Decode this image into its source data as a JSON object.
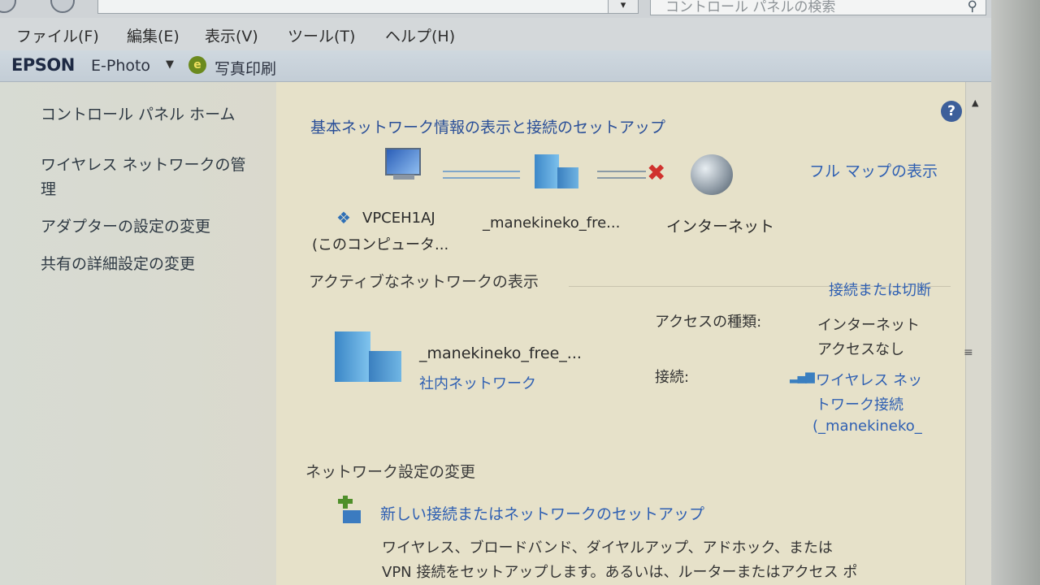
{
  "window": {
    "search_placeholder": "コントロール パネルの検索"
  },
  "menubar": {
    "items": [
      {
        "label": "ファイル(F)"
      },
      {
        "label": "編集(E)"
      },
      {
        "label": "表示(V)"
      },
      {
        "label": "ツール(T)"
      },
      {
        "label": "ヘルプ(H)"
      }
    ]
  },
  "toolbar": {
    "brand": "EPSON",
    "product": "E-Photo",
    "print_label": "写真印刷"
  },
  "sidebar": {
    "items": [
      {
        "label": "コントロール パネル ホーム"
      },
      {
        "label": "ワイヤレス ネットワークの管"
      },
      {
        "label": "理"
      },
      {
        "label": "アダプターの設定の変更"
      },
      {
        "label": "共有の詳細設定の変更"
      }
    ]
  },
  "main": {
    "title": "基本ネットワーク情報の表示と接続のセットアップ",
    "full_map": "フル マップの表示",
    "map": {
      "computer_name": "VPCEH1AJ",
      "computer_sub": "(このコンピュータ...",
      "network_name": "_manekineko_fre...",
      "internet": "インターネット"
    },
    "active_heading": "アクティブなネットワークの表示",
    "connect_link": "接続または切断",
    "active": {
      "name": "_manekineko_free_...",
      "type": "社内ネットワーク",
      "access_label": "アクセスの種類:",
      "access_value_1": "インターネット",
      "access_value_2": "アクセスなし",
      "connection_label": "接続:",
      "connection_value_1": "ワイヤレス ネッ",
      "connection_value_2": "トワーク接続",
      "connection_value_3": "(_manekineko_"
    },
    "change_heading": "ネットワーク設定の変更",
    "setup_link": "新しい接続またはネットワークのセットアップ",
    "setup_desc_1": "ワイヤレス、ブロードバンド、ダイヤルアップ、アドホック、または",
    "setup_desc_2": "VPN 接続をセットアップします。あるいは、ルーターまたはアクセス ポ"
  }
}
